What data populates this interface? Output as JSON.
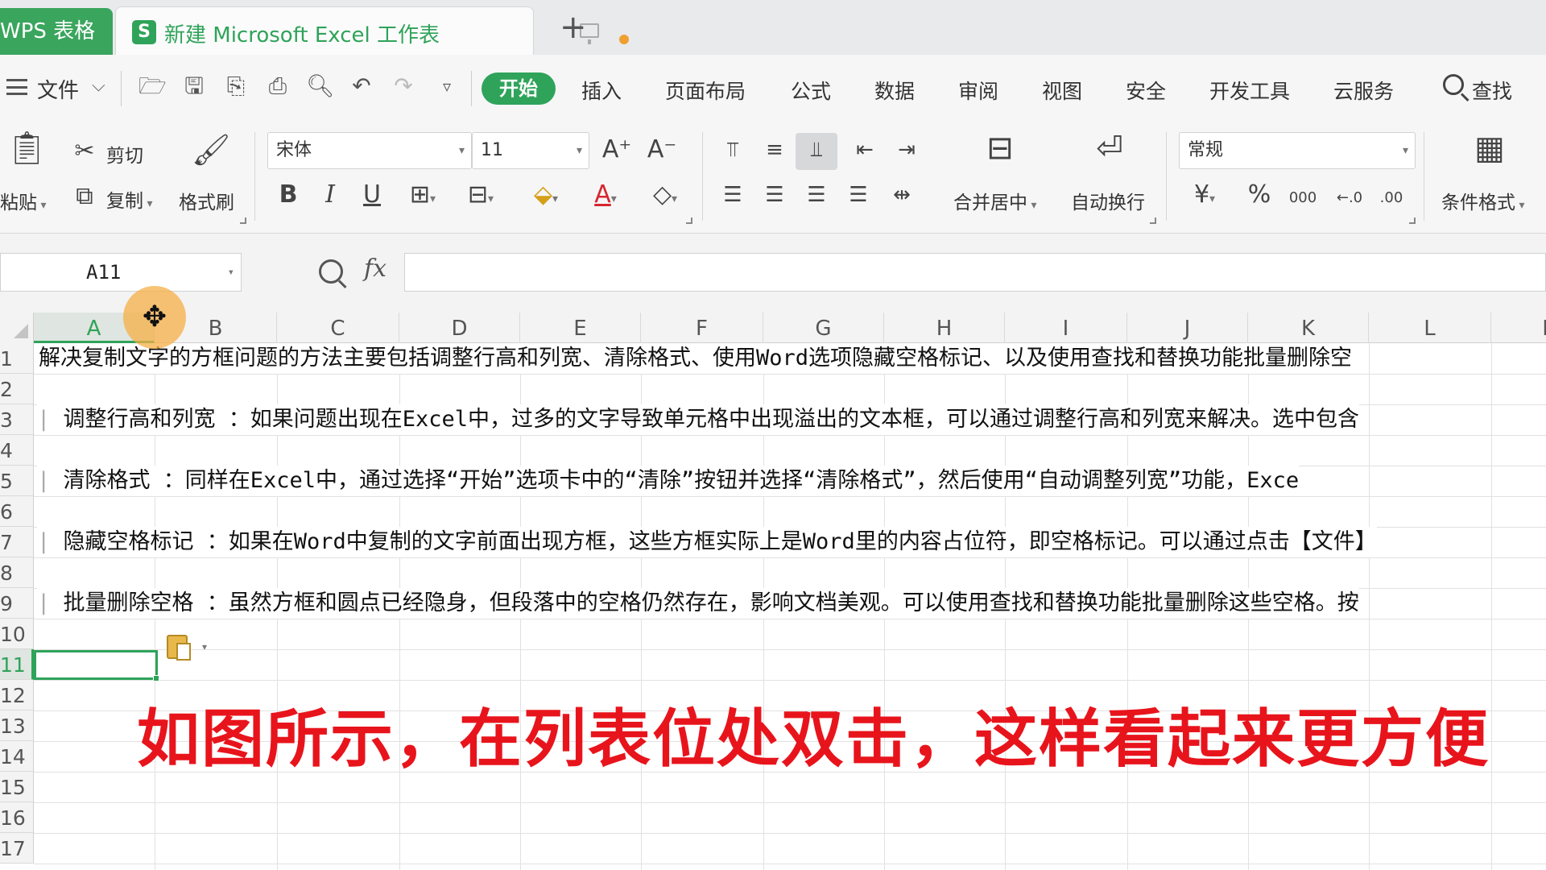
{
  "tabs": {
    "app_tab": "WPS 表格",
    "doc_tab": "新建 Microsoft Excel 工作表",
    "doc_icon_letter": "S",
    "add_tab": "+"
  },
  "menu": {
    "file_label": "文件",
    "start_label": "开始",
    "tabs": [
      "插入",
      "页面布局",
      "公式",
      "数据",
      "审阅",
      "视图",
      "安全",
      "开发工具",
      "云服务"
    ],
    "search_label": "查找"
  },
  "ribbon": {
    "paste_label": "粘贴",
    "cut_label": "剪切",
    "copy_label": "复制",
    "format_painter_label": "格式刷",
    "font_name": "宋体",
    "font_size": "11",
    "bold": "B",
    "italic": "I",
    "underline": "U",
    "font_color_glyph": "A",
    "increase_font": "A⁺",
    "decrease_font": "A⁻",
    "merge_center_label": "合并居中",
    "wrap_text_label": "自动换行",
    "number_format": "常规",
    "percent": "%",
    "thousands": "000",
    "conditional_format_label": "条件格式"
  },
  "formula_bar": {
    "name_box": "A11",
    "fx": "fx",
    "formula": ""
  },
  "sheet": {
    "columns": [
      "A",
      "B",
      "C",
      "D",
      "E",
      "F",
      "G",
      "H",
      "I",
      "J",
      "K",
      "L",
      "M"
    ],
    "rows": [
      "1",
      "2",
      "3",
      "4",
      "5",
      "6",
      "7",
      "8",
      "9",
      "10",
      "11",
      "12",
      "13",
      "14",
      "15",
      "16",
      "17"
    ],
    "active_cell": "A11",
    "cells": {
      "r1": "解决复制文字的方框问题的方法主要包括调整行高和列宽、清除格式、使用Word选项隐藏空格标记、以及使用查找和替换功能批量删除空",
      "r3": "调整行高和列宽 ：如果问题出现在Excel中，过多的文字导致单元格中出现溢出的文本框，可以通过调整行高和列宽来解决。选中包含",
      "r5": "清除格式 ：同样在Excel中，通过选择“开始”选项卡中的“清除”按钮并选择“清除格式”，然后使用“自动调整列宽”功能，Exce",
      "r7": "隐藏空格标记 ：如果在Word中复制的文字前面出现方框，这些方框实际上是Word里的内容占位符，即空格标记。可以通过点击【文件】",
      "r9": "批量删除空格 ：虽然方框和圆点已经隐身，但段落中的空格仍然存在，影响文档美观。可以使用查找和替换功能批量删除这些空格。按"
    }
  },
  "caption": "如图所示，在列表位处双击，这样看起来更方便",
  "colors": {
    "accent": "#2fa35a",
    "caption": "#e8141c",
    "cursor_halo": "#f5af46"
  }
}
